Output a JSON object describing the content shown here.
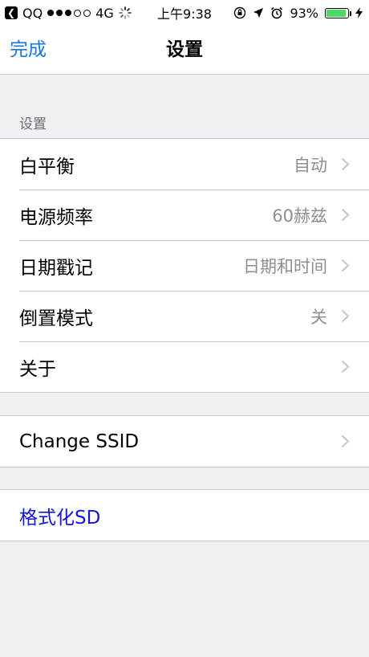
{
  "status_bar": {
    "back_app": "QQ",
    "network": "4G",
    "time": "上午9:38",
    "battery_percent": "93%",
    "battery_level": 0.93,
    "battery_color": "#4cd964"
  },
  "nav": {
    "done_label": "完成",
    "title": "设置"
  },
  "section_header": "设置",
  "settings_group": [
    {
      "label": "白平衡",
      "value": "自动"
    },
    {
      "label": "电源频率",
      "value": "60赫兹"
    },
    {
      "label": "日期戳记",
      "value": "日期和时间"
    },
    {
      "label": "倒置模式",
      "value": "关"
    },
    {
      "label": "关于",
      "value": ""
    }
  ],
  "ssid_row": {
    "label": "Change SSID"
  },
  "format_row": {
    "label": "格式化SD"
  },
  "colors": {
    "accent": "#1677e8",
    "format_text": "#1414d6",
    "background": "#efeff4",
    "secondary_text": "#8e8e93"
  }
}
